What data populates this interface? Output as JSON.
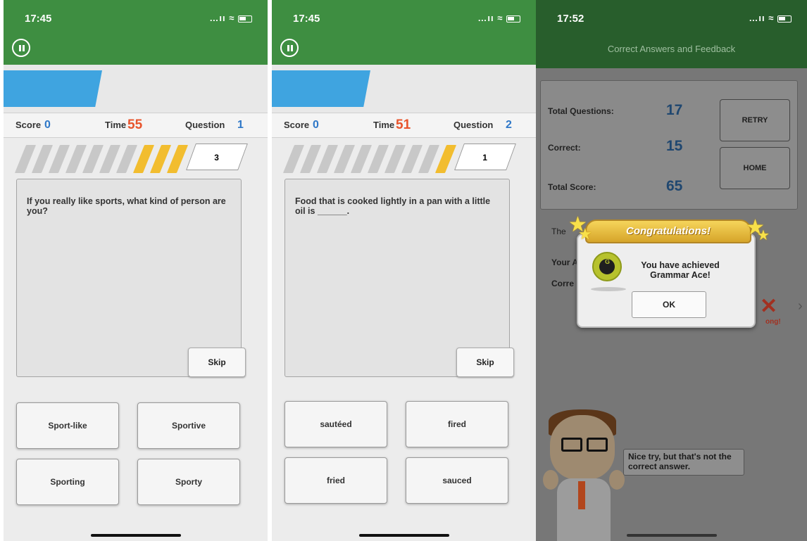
{
  "screens": [
    {
      "status_time": "17:45",
      "status_signal": "…ıı ≈",
      "score_label": "Score",
      "score_value": "0",
      "time_label": "Time",
      "time_value": "55",
      "question_label": "Question",
      "question_value": "1",
      "progress_filled_count": 3,
      "remaining_count": "3",
      "question_text": "If you really like sports, what kind of person are you?",
      "skip_label": "Skip",
      "answers": [
        "Sport-like",
        "Sportive",
        "Sporting",
        "Sporty"
      ]
    },
    {
      "status_time": "17:45",
      "status_signal": "…ıı ≈",
      "score_label": "Score",
      "score_value": "0",
      "time_label": "Time",
      "time_value": "51",
      "question_label": "Question",
      "question_value": "2",
      "progress_filled_count": 1,
      "remaining_count": "1",
      "question_text": "Food that is cooked lightly in a pan with a little oil is ______.",
      "skip_label": "Skip",
      "answers": [
        "sautéed",
        "fired",
        "fried",
        "sauced"
      ]
    }
  ],
  "results": {
    "status_time": "17:52",
    "status_signal": "…ıı ≈",
    "header_title": "Correct Answers and Feedback",
    "total_questions_label": "Total Questions:",
    "total_questions_value": "17",
    "correct_label": "Correct:",
    "correct_value": "15",
    "total_score_label": "Total Score:",
    "total_score_value": "65",
    "retry_label": "RETRY",
    "home_label": "HOME",
    "bg_the": "The",
    "bg_your": "Your A",
    "bg_corre": "Corre",
    "bg_wrong": "ong!",
    "popup": {
      "ribbon_text": "Congratulations!",
      "badge_letter": "G",
      "message_line1": "You have achieved",
      "message_line2": "Grammar Ace!",
      "ok_label": "OK"
    },
    "feedback_text": "Nice try, but that's not the correct answer."
  },
  "colors": {
    "header_green": "#3e8e41",
    "accent_blue": "#3fa4e0",
    "progress_gold": "#f2bd2f",
    "time_red": "#e8542c"
  },
  "icons": [
    "pause-icon",
    "signal-icon",
    "wifi-icon",
    "battery-icon",
    "star-icon",
    "spade-badge-icon",
    "chevron-right-icon",
    "wrong-x-icon"
  ]
}
